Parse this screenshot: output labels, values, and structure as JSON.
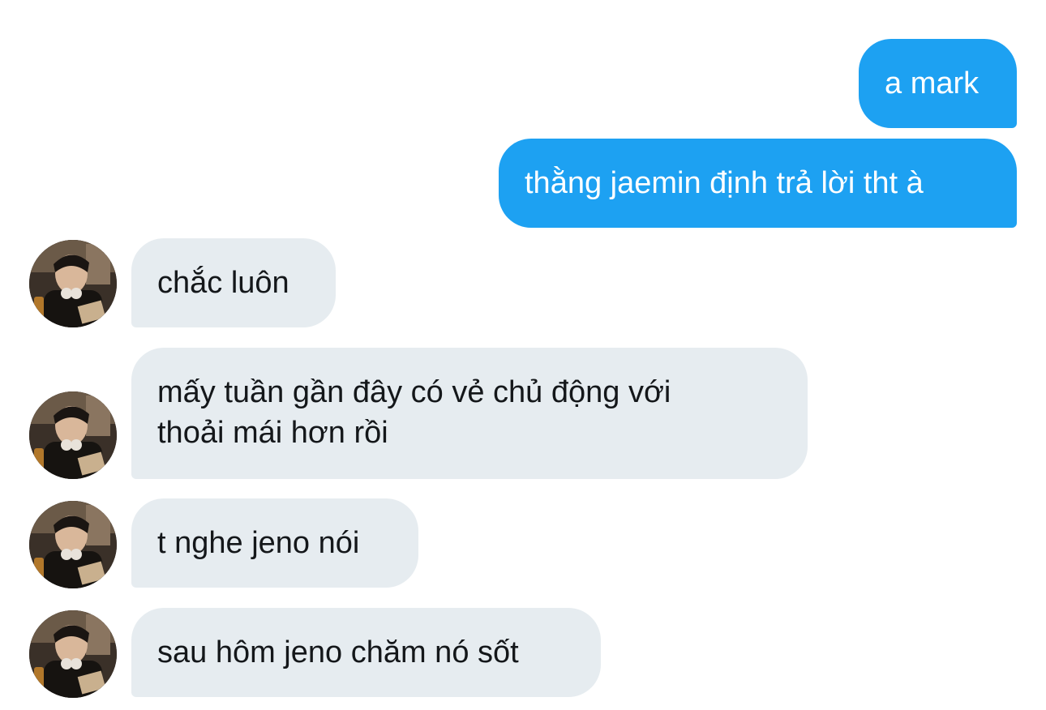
{
  "colors": {
    "sent_bubble": "#1da1f2",
    "received_bubble": "#e6ecf0",
    "sent_text": "#ffffff",
    "received_text": "#14171a"
  },
  "conversation": {
    "sent": [
      {
        "text": "a mark"
      },
      {
        "text": "thằng jaemin định trả lời tht à"
      }
    ],
    "received": [
      {
        "lines": [
          "chắc luôn"
        ],
        "avatar": "user-avatar-photo"
      },
      {
        "lines": [
          "mấy tuần gần đây có vẻ chủ động với",
          "thoải mái hơn rồi"
        ],
        "avatar": "user-avatar-photo"
      },
      {
        "lines": [
          "t nghe jeno nói"
        ],
        "avatar": "user-avatar-photo"
      },
      {
        "lines": [
          "sau hôm jeno chăm nó sốt"
        ],
        "avatar": "user-avatar-photo"
      }
    ]
  }
}
